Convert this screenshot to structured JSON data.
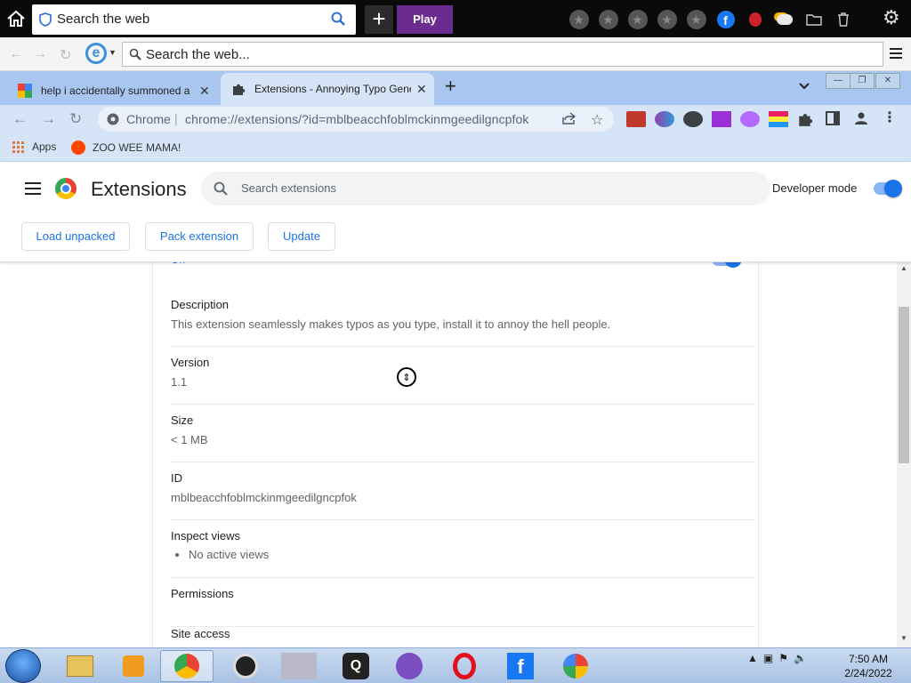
{
  "topbar": {
    "search_text": "Search the web",
    "play_label": "Play"
  },
  "iebar": {
    "address_text": "Search the web..."
  },
  "tabs": [
    {
      "title": "help i accidentally summoned a"
    },
    {
      "title": "Extensions - Annoying Typo Gene"
    }
  ],
  "omnibox": {
    "scheme_label": "Chrome",
    "url": "chrome://extensions/?id=mblbeacchfoblmckinmgeedilgncpfok"
  },
  "bookmarks": [
    {
      "label": "Apps"
    },
    {
      "label": "ZOO WEE MAMA!"
    }
  ],
  "extensions_page": {
    "title": "Extensions",
    "search_placeholder": "Search extensions",
    "developer_mode_label": "Developer mode",
    "developer_mode_on": true,
    "buttons": {
      "load_unpacked": "Load unpacked",
      "pack_extension": "Pack extension",
      "update": "Update"
    }
  },
  "details": {
    "on_fragment": "On",
    "description_label": "Description",
    "description_value": "This extension seamlessly makes typos as you type, install it to annoy the hell people.",
    "version_label": "Version",
    "version_value": "1.1",
    "size_label": "Size",
    "size_value": "< 1 MB",
    "id_label": "ID",
    "id_value": "mblbeacchfoblmckinmgeedilgncpfok",
    "inspect_label": "Inspect views",
    "inspect_item": "No active views",
    "permissions_label": "Permissions",
    "site_access_label": "Site access"
  },
  "taskbar": {
    "time": "7:50 AM",
    "date": "2/24/2022"
  },
  "colors": {
    "accent": "#1a73e8",
    "tabstrip": "#a8c6ef",
    "toolbar": "#d6e4f7",
    "play_button": "#6a2c8e"
  }
}
